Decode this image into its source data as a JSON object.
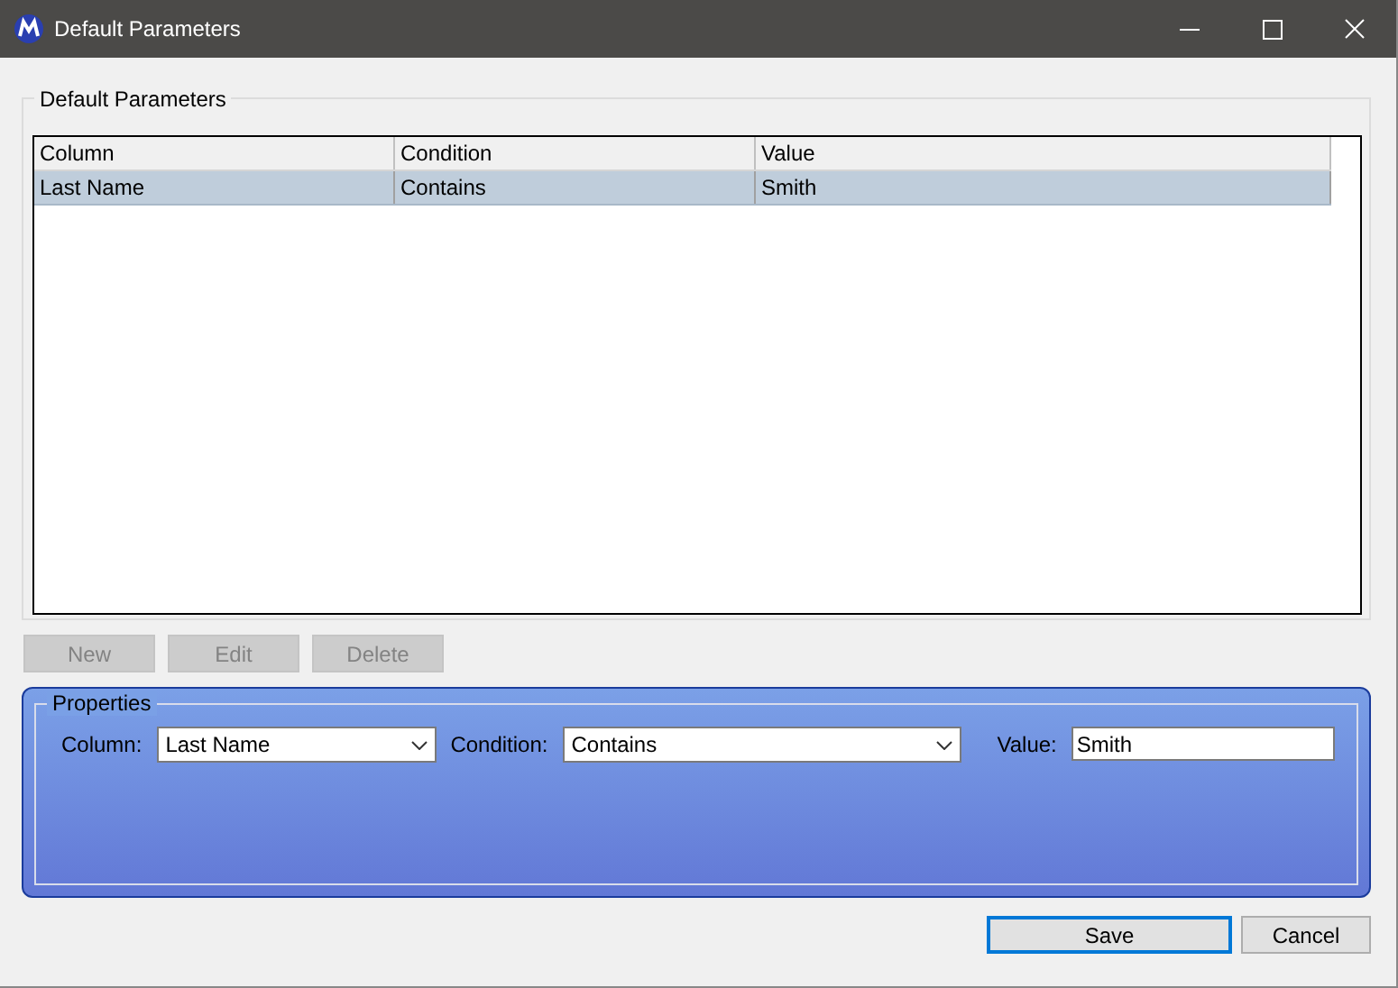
{
  "window": {
    "title": "Default Parameters"
  },
  "group": {
    "title": "Default Parameters"
  },
  "table": {
    "columns": [
      "Column",
      "Condition",
      "Value"
    ],
    "rows": [
      {
        "cells": [
          "Last Name",
          "Contains",
          "Smith"
        ],
        "selected": true
      }
    ]
  },
  "actions": [
    {
      "label": "New",
      "disabled": true
    },
    {
      "label": "Edit",
      "disabled": true
    },
    {
      "label": "Delete",
      "disabled": true
    }
  ],
  "properties": {
    "title": "Properties",
    "fields": [
      {
        "kind": "dropdown",
        "label": "Column:",
        "value": "Last Name"
      },
      {
        "kind": "dropdown",
        "label": "Condition:",
        "value": "Contains"
      },
      {
        "kind": "text",
        "label": "Value:",
        "value": "Smith"
      }
    ]
  },
  "footer": [
    {
      "label": "Save",
      "focused": true
    },
    {
      "label": "Cancel",
      "focused": false
    }
  ]
}
